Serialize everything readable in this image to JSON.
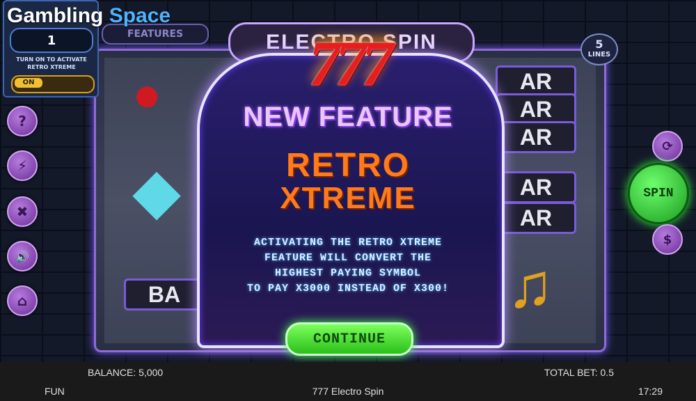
{
  "watermark": {
    "part1": "Gambling",
    "part2": "Space"
  },
  "feature_panel": {
    "value": "1",
    "note": "TURN ON TO ACTIVATE RETRO XTREME",
    "toggle_label": "ON"
  },
  "features_button": {
    "label": "FEATURES"
  },
  "game_title_plate": {
    "text": "ELECTRO SPIN"
  },
  "lines_badge": {
    "count": "5",
    "label": "LINES"
  },
  "spin_button": {
    "label": "SPIN"
  },
  "side_buttons": [
    {
      "name": "help",
      "glyph": "?"
    },
    {
      "name": "turbo",
      "glyph": "⚡"
    },
    {
      "name": "settings",
      "glyph": "✖"
    },
    {
      "name": "sound",
      "glyph": "🔊"
    },
    {
      "name": "home",
      "glyph": "⌂"
    }
  ],
  "right_buttons": [
    {
      "name": "autoplay",
      "glyph": "⟳"
    },
    {
      "name": "bet",
      "glyph": "$"
    }
  ],
  "modal": {
    "logo": "777",
    "heading": "NEW FEATURE",
    "feature_name_line1": "RETRO",
    "feature_name_line2": "XTREME",
    "description": [
      "ACTIVATING THE RETRO XTREME",
      "FEATURE WILL CONVERT THE",
      "HIGHEST PAYING SYMBOL",
      "TO PAY X3000 INSTEAD OF X300!"
    ],
    "continue_label": "CONTINUE"
  },
  "reel_symbols": {
    "bar": "BAR",
    "bar_partial": "AR",
    "bar_left": "BA"
  },
  "bottom_bar": {
    "balance": "BALANCE: 5,000",
    "total_bet": "TOTAL BET: 0.5",
    "mode": "FUN",
    "game_name": "777 Electro Spin",
    "clock": "17:29"
  },
  "colors": {
    "accent_purple": "#b38cff",
    "spin_green": "#2bbf1a",
    "feature_orange": "#ff7a1a",
    "seven_red": "#e81e1e"
  }
}
